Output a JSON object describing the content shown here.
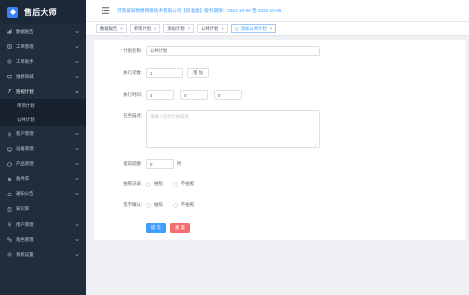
{
  "brand": {
    "title": "售后大师"
  },
  "sidebar": {
    "items": [
      {
        "label": "数据报告",
        "icon": "chart-icon"
      },
      {
        "label": "工单管理",
        "icon": "ticket-icon"
      },
      {
        "label": "工单助手",
        "icon": "assistant-icon"
      },
      {
        "label": "维修商城",
        "icon": "shop-icon"
      },
      {
        "label": "巡视计划",
        "icon": "wrench-icon"
      },
      {
        "label": "客户管理",
        "icon": "customer-icon"
      },
      {
        "label": "设备管理",
        "icon": "device-icon"
      },
      {
        "label": "产品管理",
        "icon": "product-icon"
      },
      {
        "label": "备件库",
        "icon": "parts-icon"
      },
      {
        "label": "通知公告",
        "icon": "notice-icon"
      },
      {
        "label": "知识库",
        "icon": "knowledge-icon"
      },
      {
        "label": "用户管理",
        "icon": "user-icon"
      },
      {
        "label": "角色管理",
        "icon": "role-icon"
      },
      {
        "label": "系统设置",
        "icon": "settings-icon"
      }
    ],
    "submenu": [
      {
        "label": "单项计划"
      },
      {
        "label": "公共计划"
      }
    ]
  },
  "header": {
    "info": "河南爱知物楼网络技术有限公司【标准版】服务期限：2021-10-08 至 2022-10-08"
  },
  "tabs": [
    {
      "label": "数据报告"
    },
    {
      "label": "单项计划"
    },
    {
      "label": "添加计划"
    },
    {
      "label": "公共计划"
    },
    {
      "label": "添加公共计划"
    }
  ],
  "form": {
    "name_label": "计划名称:",
    "name_value": "公共计划",
    "count_label": "执行次数:",
    "count_value": "1",
    "count_button": "增 加",
    "time_label": "执行时间:",
    "time_values": [
      "4",
      "0",
      "0"
    ],
    "desc_label": "任务描述:",
    "desc_placeholder": "请输入您的计划描述",
    "remind_label": "提前提醒:",
    "remind_value": "0",
    "remind_unit": "时",
    "photo_label": "拍照记录:",
    "sign_label": "签字确认:",
    "radio_yes": "拍照",
    "radio_no": "不拍照",
    "submit": "提 交",
    "reset": "重 置"
  },
  "colors": {
    "sidebar_bg": "#1f2d3d",
    "accent": "#409eff",
    "danger": "#f56c6c"
  }
}
